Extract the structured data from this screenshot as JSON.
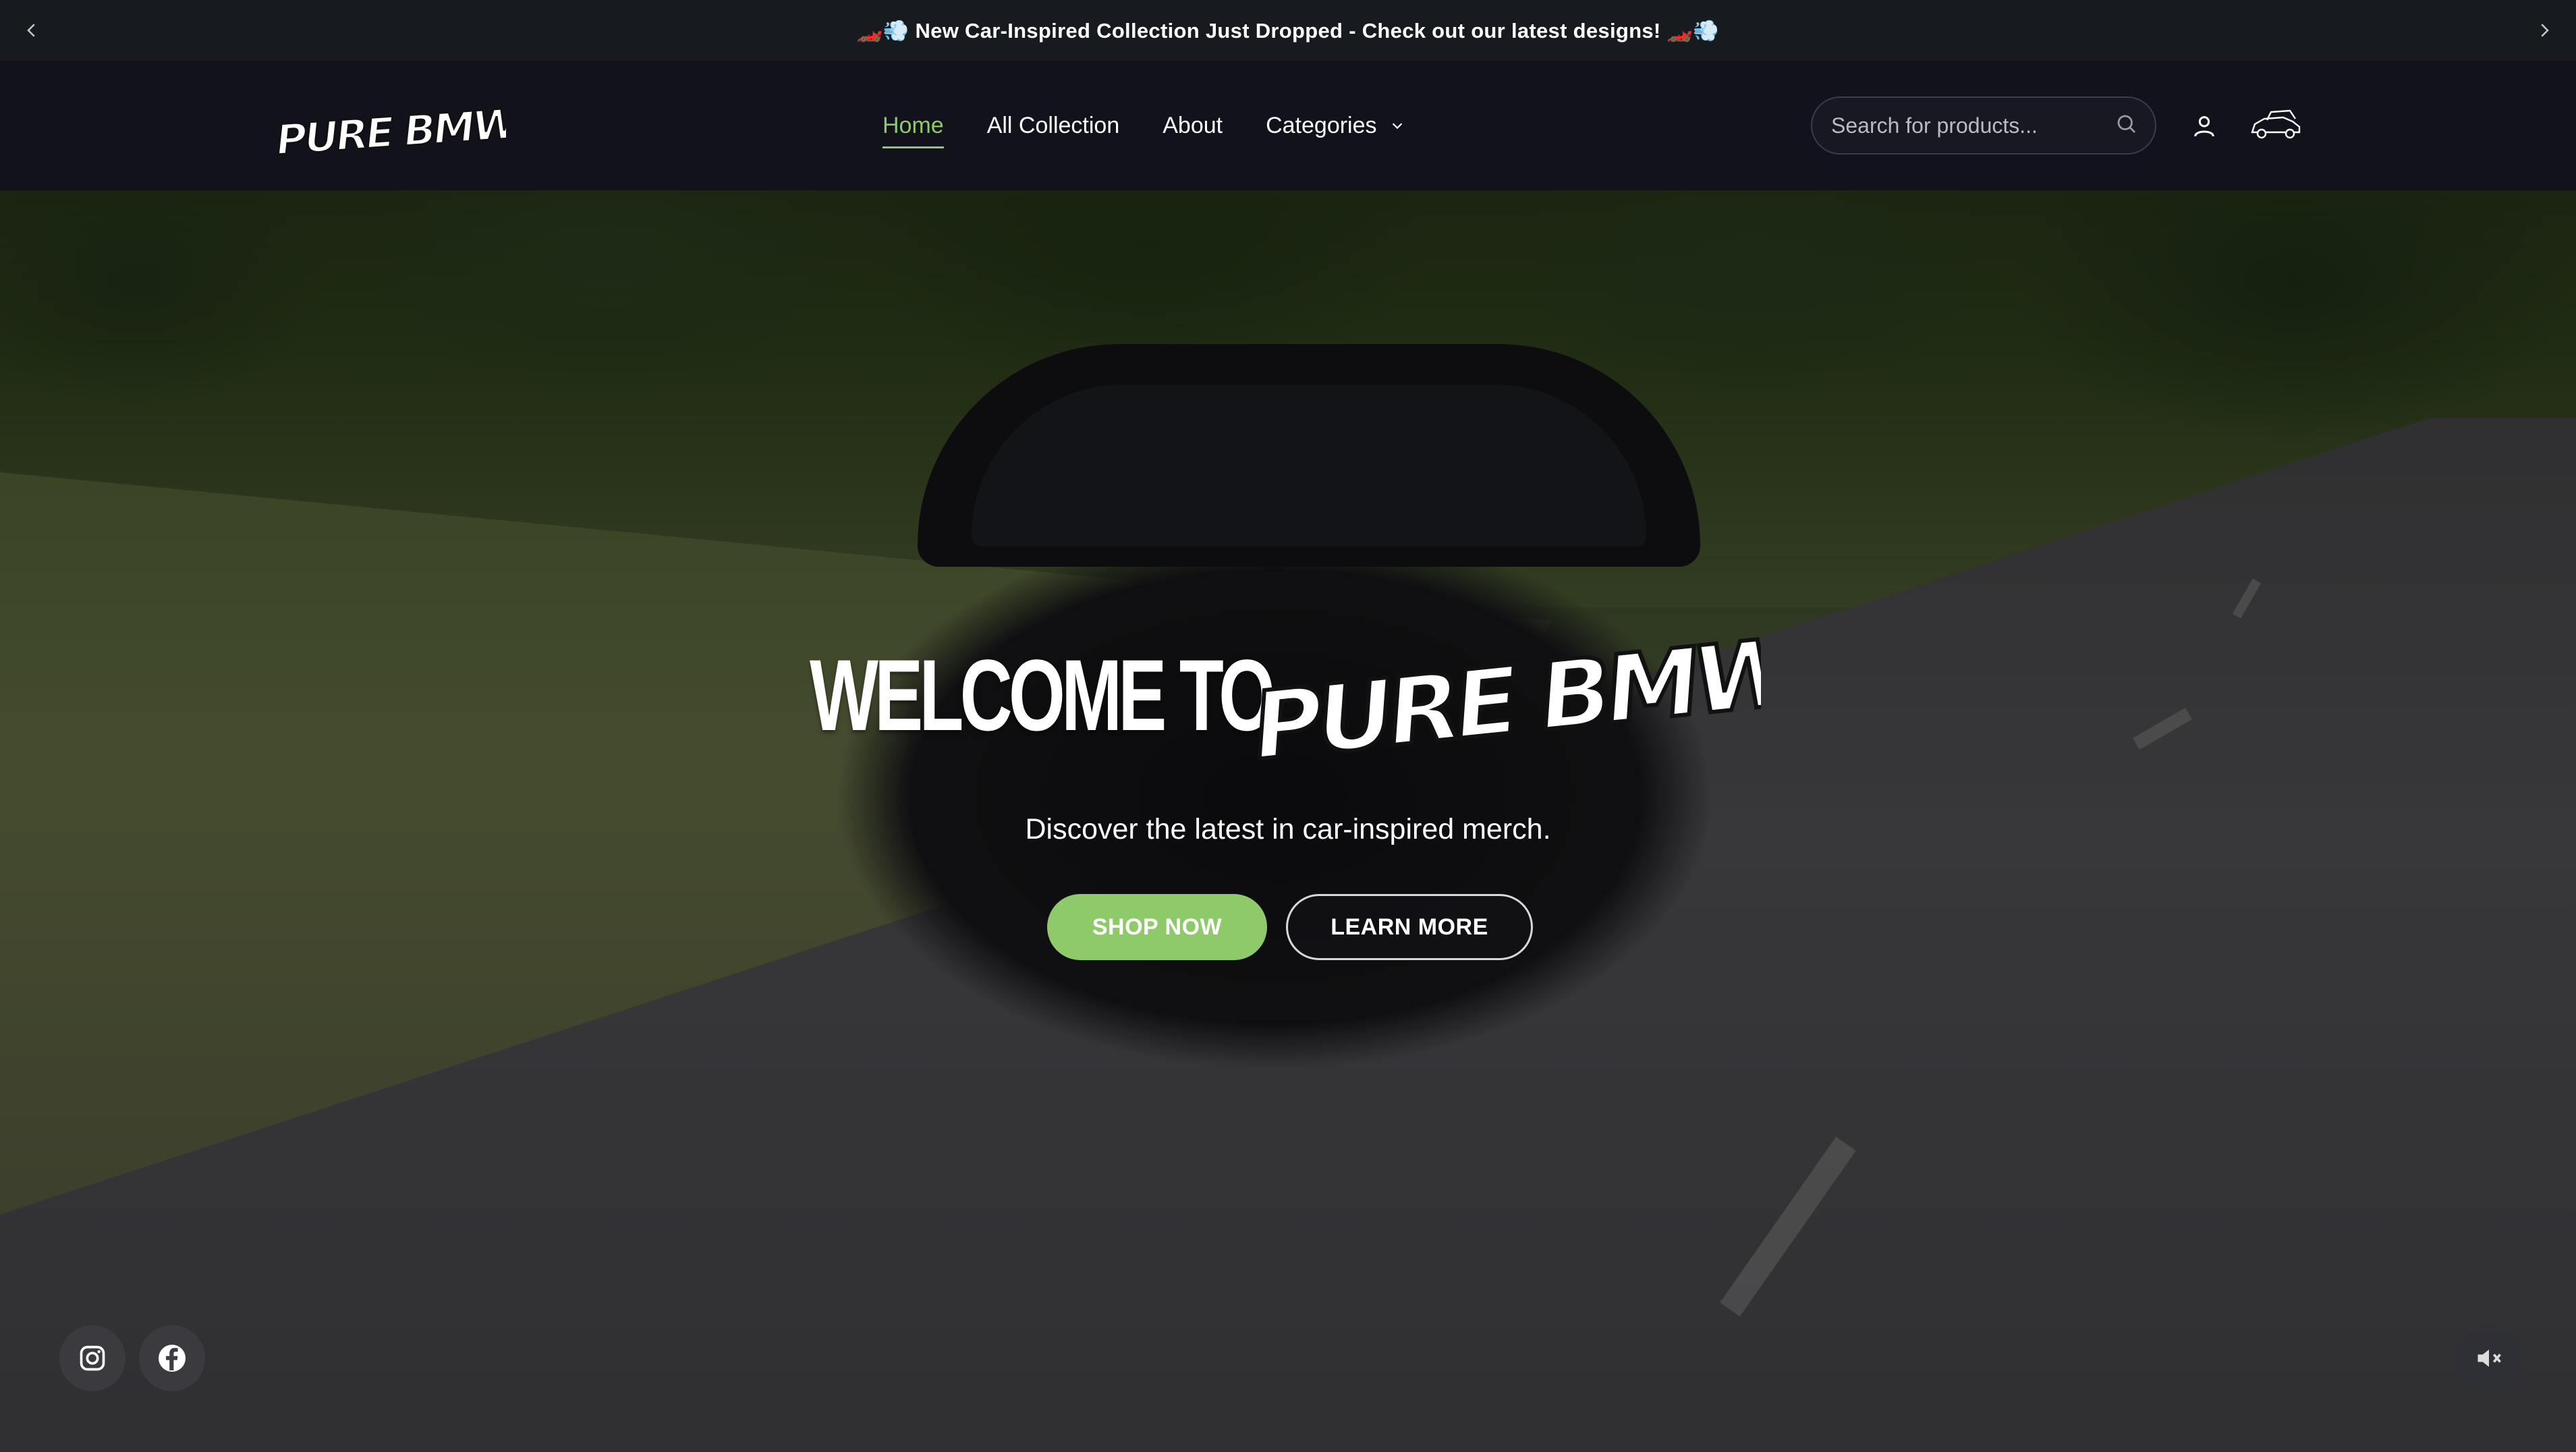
{
  "announcement": {
    "text": "🏎️💨 New Car-Inspired Collection Just Dropped - Check out our latest designs! 🏎️💨",
    "prev_icon": "chevron-left-icon",
    "next_icon": "chevron-right-icon"
  },
  "header": {
    "logo_text": "PURE BMW",
    "nav": [
      {
        "label": "Home",
        "active": true
      },
      {
        "label": "All Collection",
        "active": false
      },
      {
        "label": "About",
        "active": false
      },
      {
        "label": "Categories",
        "active": false,
        "has_dropdown": true
      }
    ],
    "search": {
      "placeholder": "Search for products..."
    },
    "account_icon": "user-icon",
    "cart_icon": "car-cart-icon"
  },
  "hero": {
    "welcome_text": "WELCOME TO",
    "brand_logo_text": "PURE BMW",
    "tagline": "Discover the latest in car-inspired merch.",
    "primary_button": "SHOP NOW",
    "secondary_button": "LEARN MORE"
  },
  "social": {
    "instagram_icon": "instagram-icon",
    "facebook_icon": "facebook-icon"
  },
  "mute_icon": "speaker-muted-icon",
  "colors": {
    "accent": "#8ec96a",
    "header_bg": "#11121b",
    "text": "#ffffff"
  }
}
